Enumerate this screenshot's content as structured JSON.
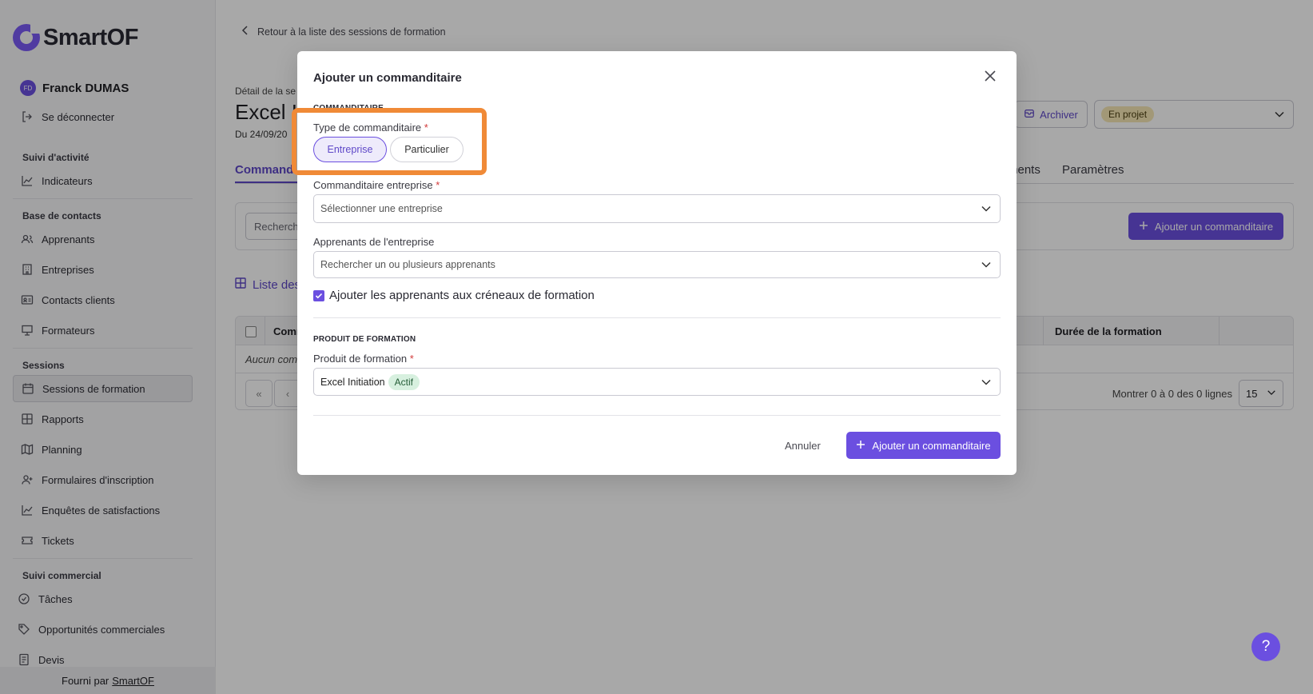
{
  "sidebar": {
    "logo_text": "SmartOF",
    "user": {
      "initials": "FD",
      "name": "Franck DUMAS"
    },
    "logout": "Se déconnecter",
    "sections": {
      "activity": "Suivi d'activité",
      "contacts": "Base de contacts",
      "sessions": "Sessions",
      "commercial": "Suivi commercial"
    },
    "items": {
      "indicators": "Indicateurs",
      "learners": "Apprenants",
      "companies": "Entreprises",
      "client_contacts": "Contacts clients",
      "trainers": "Formateurs",
      "training_sessions": "Sessions de formation",
      "reports": "Rapports",
      "planning": "Planning",
      "forms": "Formulaires d'inscription",
      "surveys": "Enquêtes de satisfactions",
      "tickets": "Tickets",
      "tasks": "Tâches",
      "opportunities": "Opportunités commerciales",
      "quotes": "Devis"
    },
    "footer_text": "Fourni par",
    "footer_link": "SmartOF"
  },
  "main": {
    "back_link": "Retour à la liste des sessions de formation",
    "detail_label": "Détail de la se",
    "title": "Excel I",
    "dates": "Du 24/09/20",
    "archive_label": "Archiver",
    "status_value": "En projet",
    "tabs": {
      "commanditaires": "Commandi",
      "documents": "ments",
      "parametres": "Paramètres"
    },
    "search_placeholder": "Recherche",
    "add_sponsor": "Ajouter un commanditaire",
    "list_title": "Liste des",
    "table": {
      "col_sponsor": "Comm",
      "col_duration": "Durée de la formation",
      "empty": "Aucun com"
    },
    "pager": {
      "first": "«",
      "prev": "‹",
      "info": "Montrer 0 à 0 des 0 lignes",
      "per_page": "15"
    }
  },
  "modal": {
    "title": "Ajouter un commanditaire",
    "section_sponsor": "COMMANDITAIRE",
    "type_label": "Type de commanditaire",
    "required_mark": "*",
    "type_options": {
      "company": "Entreprise",
      "individual": "Particulier"
    },
    "company_label": "Commanditaire entreprise",
    "company_placeholder": "Sélectionner une entreprise",
    "learners_label": "Apprenants de l'entreprise",
    "learners_placeholder": "Rechercher un ou plusieurs apprenants",
    "add_learners_checkbox": "Ajouter les apprenants aux créneaux de formation",
    "section_product": "PRODUIT DE FORMATION",
    "product_label": "Produit de formation",
    "product_value": "Excel Initiation",
    "product_badge": "Actif",
    "cancel": "Annuler",
    "submit": "Ajouter un commanditaire"
  },
  "help_label": "?",
  "colors": {
    "accent": "#6b4fe0",
    "highlight": "#f08a37",
    "status_yellow": "#f6e7b5",
    "active_green": "#d7f0df"
  }
}
